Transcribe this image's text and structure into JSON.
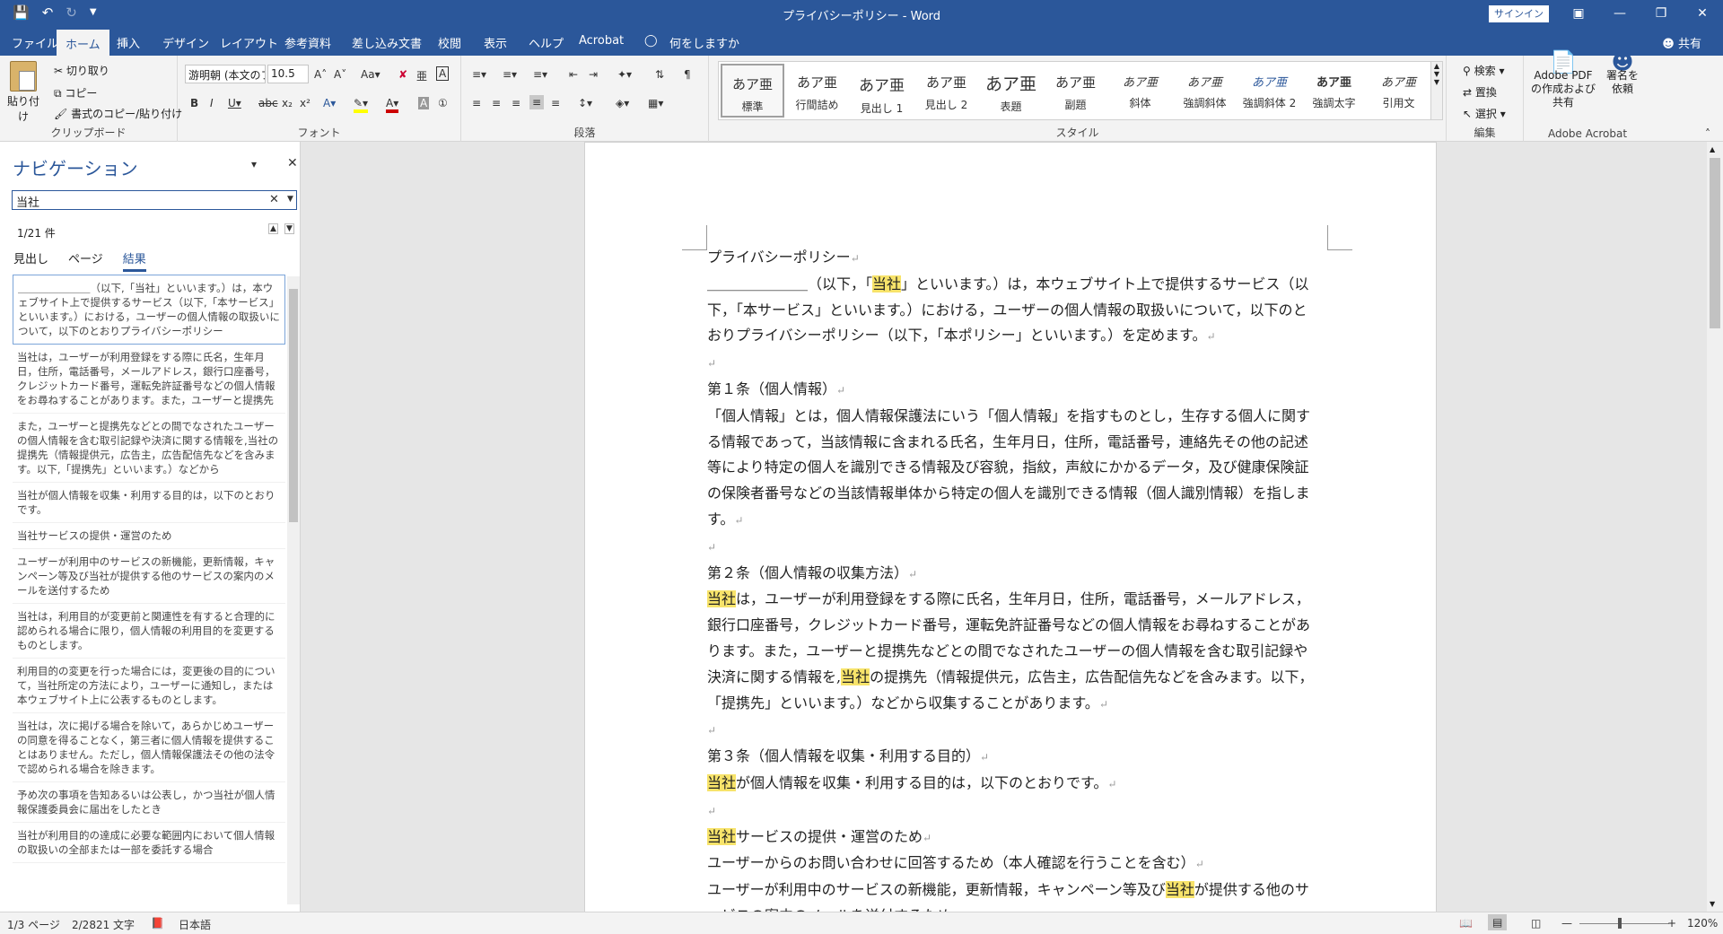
{
  "titlebar": {
    "title": "プライバシーポリシー - Word",
    "signin": "サインイン"
  },
  "ribbon_tabs": [
    "ファイル",
    "ホーム",
    "挿入",
    "デザイン",
    "レイアウト",
    "参考資料",
    "差し込み文書",
    "校閲",
    "表示",
    "ヘルプ",
    "Acrobat",
    "何をしますか"
  ],
  "share": "共有",
  "clipboard": {
    "paste": "貼り付け",
    "cut": "切り取り",
    "copy": "コピー",
    "format_painter": "書式のコピー/貼り付け",
    "label": "クリップボード"
  },
  "font": {
    "name": "游明朝 (本文のフ",
    "size": "10.5",
    "label": "フォント"
  },
  "paragraph": {
    "label": "段落"
  },
  "styles": {
    "label": "スタイル",
    "items": [
      {
        "sample": "あア亜",
        "name": "標準"
      },
      {
        "sample": "あア亜",
        "name": "行間詰め"
      },
      {
        "sample": "あア亜",
        "name": "見出し 1"
      },
      {
        "sample": "あア亜",
        "name": "見出し 2"
      },
      {
        "sample": "あア亜",
        "name": "表題"
      },
      {
        "sample": "あア亜",
        "name": "副題"
      },
      {
        "sample": "あア亜",
        "name": "斜体"
      },
      {
        "sample": "あア亜",
        "name": "強調斜体"
      },
      {
        "sample": "あア亜",
        "name": "強調斜体 2"
      },
      {
        "sample": "あア亜",
        "name": "強調太字"
      },
      {
        "sample": "あア亜",
        "name": "引用文"
      }
    ]
  },
  "editing": {
    "find": "検索",
    "replace": "置換",
    "select": "選択",
    "label": "編集"
  },
  "acrobat": {
    "create": "Adobe PDF の作成および共有",
    "sign": "署名を依頼",
    "label": "Adobe Acrobat"
  },
  "nav": {
    "title": "ナビゲーション",
    "search_value": "当社",
    "count": "1/21 件",
    "tabs": [
      "見出し",
      "ページ",
      "結果"
    ],
    "results": [
      "＿＿＿＿＿＿＿（以下,「当社」といいます。）は，本ウェブサイト上で提供するサービス（以下,「本サービス」といいます。）における，ユーザーの個人情報の取扱いについて，以下のとおりプライバシーポリシー",
      "当社は，ユーザーが利用登録をする際に氏名，生年月日，住所，電話番号，メールアドレス，銀行口座番号，クレジットカード番号，運転免許証番号などの個人情報をお尋ねすることがあります。また，ユーザーと提携先",
      "また，ユーザーと提携先などとの間でなされたユーザーの個人情報を含む取引記録や決済に関する情報を,当社の提携先（情報提供元，広告主，広告配信先などを含みます。以下,「提携先」といいます。）などから",
      "当社が個人情報を収集・利用する目的は，以下のとおりです。",
      "当社サービスの提供・運営のため",
      "ユーザーが利用中のサービスの新機能，更新情報，キャンペーン等及び当社が提供する他のサービスの案内のメールを送付するため",
      "当社は，利用目的が変更前と関連性を有すると合理的に認められる場合に限り，個人情報の利用目的を変更するものとします。",
      "利用目的の変更を行った場合には，変更後の目的について，当社所定の方法により，ユーザーに通知し，または本ウェブサイト上に公表するものとします。",
      "当社は，次に掲げる場合を除いて，あらかじめユーザーの同意を得ることなく，第三者に個人情報を提供することはありません。ただし，個人情報保護法その他の法令で認められる場合を除きます。",
      "予め次の事項を告知あるいは公表し，かつ当社が個人情報保護委員会に届出をしたとき",
      "当社が利用目的の達成に必要な範囲内において個人情報の取扱いの全部または一部を委託する場合"
    ]
  },
  "document": {
    "paragraphs": [
      [
        {
          "t": "プライバシーポリシー"
        }
      ],
      [
        {
          "t": "＿＿＿＿＿＿＿（以下，「"
        },
        {
          "t": "当社",
          "hl": true
        },
        {
          "t": "」といいます。）は，本ウェブサイト上で提供するサービス（以下，「本サービス」といいます。）における，ユーザーの個人情報の取扱いについて，以下のとおりプライバシーポリシー（以下，「本ポリシー」といいます。）を定めます。"
        }
      ],
      [
        {
          "t": ""
        }
      ],
      [
        {
          "t": "第１条（個人情報）"
        }
      ],
      [
        {
          "t": "「個人情報」とは，個人情報保護法にいう「個人情報」を指すものとし，生存する個人に関する情報であって，当該情報に含まれる氏名，生年月日，住所，電話番号，連絡先その他の記述等により特定の個人を識別できる情報及び容貌，指紋，声紋にかかるデータ，及び健康保険証の保険者番号などの当該情報単体から特定の個人を識別できる情報（個人識別情報）を指します。"
        }
      ],
      [
        {
          "t": ""
        }
      ],
      [
        {
          "t": "第２条（個人情報の収集方法）"
        }
      ],
      [
        {
          "t": "当社",
          "hl": true
        },
        {
          "t": "は，ユーザーが利用登録をする際に氏名，生年月日，住所，電話番号，メールアドレス，銀行口座番号，クレジットカード番号，運転免許証番号などの個人情報をお尋ねすることがあります。また，ユーザーと提携先などとの間でなされたユーザーの個人情報を含む取引記録や決済に関する情報を,"
        },
        {
          "t": "当社",
          "hl": true
        },
        {
          "t": "の提携先（情報提供元，広告主，広告配信先などを含みます。以下，「提携先」といいます。）などから収集することがあります。"
        }
      ],
      [
        {
          "t": ""
        }
      ],
      [
        {
          "t": "第３条（個人情報を収集・利用する目的）"
        }
      ],
      [
        {
          "t": "当社",
          "hl": true
        },
        {
          "t": "が個人情報を収集・利用する目的は，以下のとおりです。"
        }
      ],
      [
        {
          "t": ""
        }
      ],
      [
        {
          "t": "当社",
          "hl": true
        },
        {
          "t": "サービスの提供・運営のため"
        }
      ],
      [
        {
          "t": "ユーザーからのお問い合わせに回答するため（本人確認を行うことを含む）"
        }
      ],
      [
        {
          "t": "ユーザーが利用中のサービスの新機能，更新情報，キャンペーン等及び"
        },
        {
          "t": "当社",
          "hl": true
        },
        {
          "t": "が提供する他のサービスの案内のメールを送付するため"
        }
      ]
    ]
  },
  "status": {
    "page": "1/3 ページ",
    "words": "2/2821 文字",
    "lang": "日本語",
    "zoom": "120%"
  },
  "colors": {
    "accent": "#2b579a",
    "highlight": "#f7e36a"
  }
}
